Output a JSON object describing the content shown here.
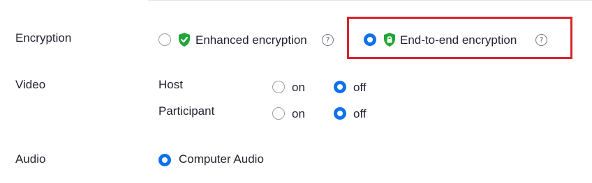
{
  "encryption": {
    "label": "Encryption",
    "options": [
      {
        "label": "Enhanced encryption",
        "selected": false,
        "icon": "shield-check-icon"
      },
      {
        "label": "End-to-end encryption",
        "selected": true,
        "icon": "shield-lock-icon"
      }
    ],
    "help_glyph": "?"
  },
  "video": {
    "label": "Video",
    "rows": [
      {
        "label": "Host",
        "on_label": "on",
        "off_label": "off",
        "selected": "off"
      },
      {
        "label": "Participant",
        "on_label": "on",
        "off_label": "off",
        "selected": "off"
      }
    ]
  },
  "audio": {
    "label": "Audio",
    "option": {
      "label": "Computer Audio",
      "selected": true
    }
  },
  "colors": {
    "accent": "#0e72ed",
    "shield_green": "#23a638",
    "highlight": "#d8232a"
  }
}
